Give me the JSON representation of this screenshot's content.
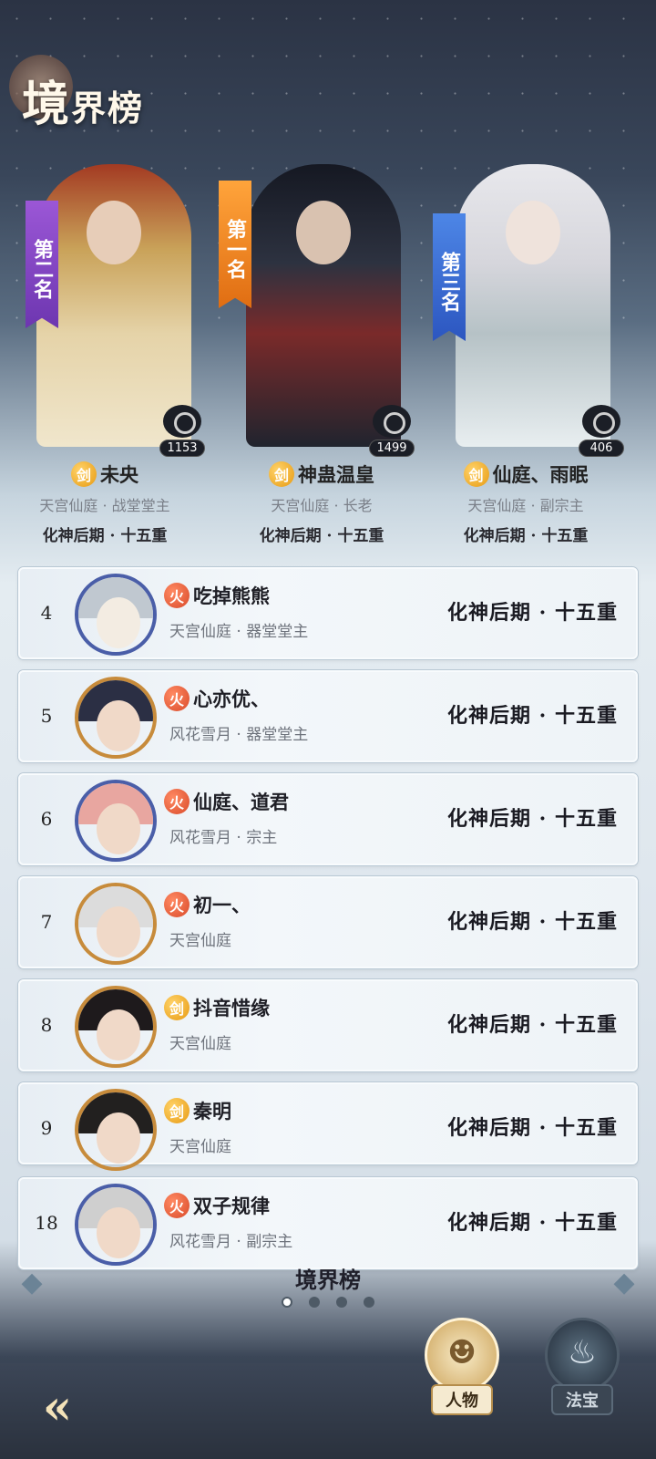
{
  "title": {
    "main": "境",
    "rest": "界榜"
  },
  "podium": [
    {
      "rank_label": "第二名",
      "likes": "1153",
      "element": "剑",
      "name": "未央",
      "sect": "天宫仙庭 · 战堂堂主",
      "realm": "化神后期 · 十五重"
    },
    {
      "rank_label": "第一名",
      "likes": "1499",
      "element": "剑",
      "name": "神蛊温皇",
      "sect": "天宫仙庭 · 长老",
      "realm": "化神后期 · 十五重"
    },
    {
      "rank_label": "第三名",
      "likes": "406",
      "element": "剑",
      "name": "仙庭、雨眠",
      "sect": "天宫仙庭 · 副宗主",
      "realm": "化神后期 · 十五重"
    }
  ],
  "rows": [
    {
      "rank": "4",
      "element": "火",
      "name": "吃掉熊熊",
      "sect": "天宫仙庭 · 器堂堂主",
      "realm": "化神后期 · 十五重"
    },
    {
      "rank": "5",
      "element": "火",
      "name": "心亦优、",
      "sect": "风花雪月 · 器堂堂主",
      "realm": "化神后期 · 十五重"
    },
    {
      "rank": "6",
      "element": "火",
      "name": "仙庭、道君",
      "sect": "风花雪月 · 宗主",
      "realm": "化神后期 · 十五重"
    },
    {
      "rank": "7",
      "element": "火",
      "name": "初一、",
      "sect": "天宫仙庭",
      "realm": "化神后期 · 十五重"
    },
    {
      "rank": "8",
      "element": "剑",
      "name": "抖音惜缘",
      "sect": "天宫仙庭",
      "realm": "化神后期 · 十五重"
    },
    {
      "rank": "9",
      "element": "剑",
      "name": "秦明",
      "sect": "天宫仙庭",
      "realm": "化神后期 · 十五重"
    },
    {
      "rank": "18",
      "element": "火",
      "name": "双子规律",
      "sect": "风花雪月 · 副宗主",
      "realm": "化神后期 · 十五重"
    }
  ],
  "pager": {
    "label": "境界榜",
    "pages": 4,
    "current": 1
  },
  "tabs": {
    "person": "人物",
    "treasure": "法宝"
  },
  "icons": {
    "back": "back-arrow-icon",
    "like": "like-bubble-icon",
    "person_tab": "person-silhouette-icon",
    "treasure_tab": "gourd-icon"
  },
  "colors": {
    "rank1": "#e88a1f",
    "rank2": "#8a4bd0",
    "rank3": "#3c6fd6",
    "sword_badge": "#f0a820",
    "fire_badge": "#e05a36"
  }
}
